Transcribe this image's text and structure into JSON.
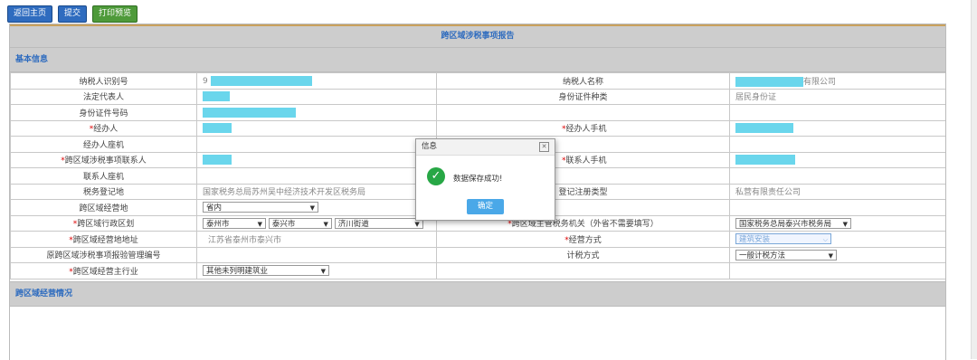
{
  "toolbar": {
    "back": "返回主页",
    "submit": "提交",
    "print": "打印预览"
  },
  "title": "跨区域涉税事项报告",
  "sections": {
    "basic": "基本信息",
    "ops": "跨区域经营情况"
  },
  "rows": {
    "r1": {
      "l1": "纳税人识别号",
      "v1_prefix": "9",
      "l2": "纳税人名称",
      "v2_suffix": "有限公司"
    },
    "r2": {
      "l1": "法定代表人",
      "l2": "身份证件种类",
      "v2": "居民身份证"
    },
    "r3": {
      "l1": "身份证件号码"
    },
    "r4": {
      "req": "*",
      "l1": "经办人",
      "req2": "*",
      "l2": "经办人手机"
    },
    "r5": {
      "l1": "经办人座机"
    },
    "r6": {
      "req": "*",
      "l1": "跨区域涉税事项联系人",
      "req2": "*",
      "l2": "联系人手机"
    },
    "r7": {
      "l1": "联系人座机"
    },
    "r8": {
      "l1": "税务登记地",
      "v1": "国家税务总局苏州吴中经济技术开发区税务局",
      "l2": "登记注册类型",
      "v2": "私营有限责任公司"
    },
    "r9": {
      "l1": "跨区域经营地",
      "sel1": "省内"
    },
    "r10": {
      "req": "*",
      "l1": "跨区域行政区划",
      "sel_city": "泰州市",
      "sel_county": "泰兴市",
      "sel_street": "济川街道",
      "req2": "*",
      "l2": "跨区域主管税务机关（外省不需要填写）",
      "sel_org": "国家税务总局泰兴市税务局"
    },
    "r11": {
      "req": "*",
      "l1": "跨区域经营地地址",
      "v1": "江苏省泰州市泰兴市",
      "req2": "*",
      "l2": "经营方式",
      "sel_mode": "建筑安装"
    },
    "r12": {
      "l1": "原跨区域涉税事项报验管理编号",
      "l2": "计税方式",
      "sel_tax": "一般计税方法"
    },
    "r13": {
      "req": "*",
      "l1": "跨区域经营主行业",
      "sel_ind": "其他未列明建筑业"
    }
  },
  "dialog": {
    "title": "信息",
    "message": "数据保存成功!",
    "ok": "确定",
    "close": "✕"
  },
  "colors": {
    "mask": "#6ad6ec",
    "header_bg": "#cdcdcd",
    "accent": "#2f6cbf"
  }
}
